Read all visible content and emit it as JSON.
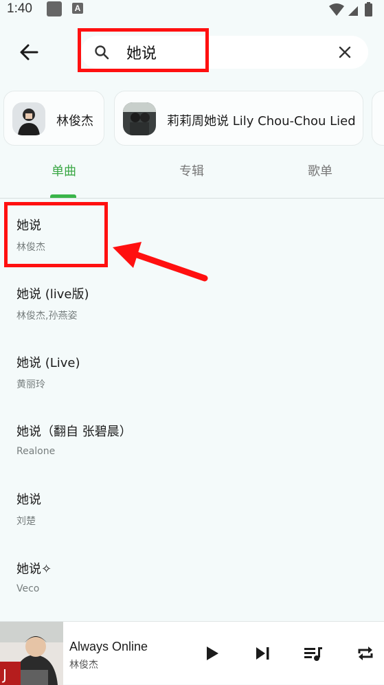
{
  "status_bar": {
    "time": "1:40",
    "app_badge": "A"
  },
  "search": {
    "query": "她说"
  },
  "chips": [
    {
      "label": "林俊杰"
    },
    {
      "label": "莉莉周她说 Lily Chou-Chou Lied"
    }
  ],
  "tabs": [
    {
      "label": "单曲",
      "active": true
    },
    {
      "label": "专辑"
    },
    {
      "label": "歌单"
    }
  ],
  "songs": [
    {
      "title": "她说",
      "artist": "林俊杰"
    },
    {
      "title": "她说 (live版)",
      "artist": "林俊杰,孙燕姿"
    },
    {
      "title": "她说 (Live)",
      "artist": "黄丽玲"
    },
    {
      "title": "她说（翻自 张碧晨）",
      "artist": "Realone"
    },
    {
      "title": "她说",
      "artist": "刘楚"
    },
    {
      "title": "她说✧",
      "artist": "Veco"
    }
  ],
  "now_playing": {
    "title": "Always Online",
    "artist": "林俊杰"
  },
  "colors": {
    "accent": "#3ab54a",
    "highlight": "#ff1010",
    "background": "#f4fafa"
  },
  "icons": [
    "back-arrow-icon",
    "search-icon",
    "close-icon",
    "play-icon",
    "skip-next-icon",
    "queue-music-icon",
    "repeat-icon"
  ]
}
